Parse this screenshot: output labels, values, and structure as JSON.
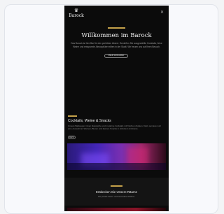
{
  "site": {
    "logo": "Barock",
    "logo_mark": "♛"
  },
  "hero": {
    "title": "Willkommen im Barock",
    "text": "Das Barock ist Ihre Bar für den perfekten Abend. Genießen Sie ausgewählte Cocktails, feine Weine und entspannte Atmosphäre mitten in der Stadt. Wir freuen uns auf Ihren Besuch.",
    "button_label": "MEHR ERFAHREN"
  },
  "section1": {
    "title": "Cocktails, Weine & Snacks",
    "text": "Unsere Barkeeper mixen klassische und moderne Cocktails mit frischen Zutaten. Dazu servieren wir eine Auswahl an Weinen, Bieren und kleinen Snacks in stilvollem Ambiente.",
    "pill_label": "MEHR"
  },
  "section2": {
    "title": "Entdecken Sie Unsere Räume",
    "text": "Für private Feiern und besondere Anlässe."
  },
  "colors": {
    "accent": "#c5a24a",
    "background": "#0b0b0b"
  },
  "icons": {
    "menu": "menu-icon"
  }
}
